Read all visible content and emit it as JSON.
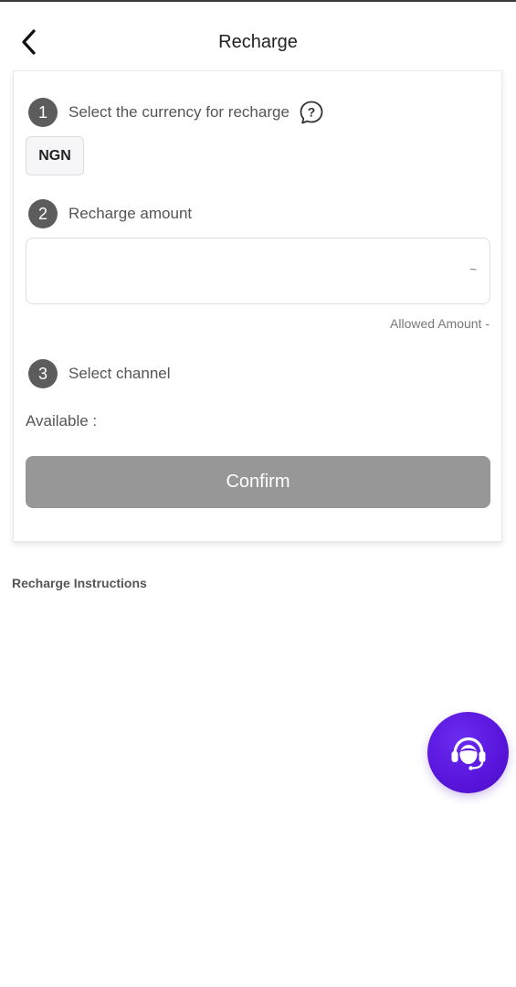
{
  "header": {
    "title": "Recharge",
    "back_icon": "chevron-left-icon"
  },
  "steps": [
    {
      "number": "1",
      "label": "Select the currency for recharge"
    },
    {
      "number": "2",
      "label": "Recharge amount"
    },
    {
      "number": "3",
      "label": "Select channel"
    }
  ],
  "currency": {
    "selected": "NGN"
  },
  "amount": {
    "value": "",
    "placeholder": "",
    "range_separator": "~",
    "allowed_label": "Allowed Amount -"
  },
  "channel": {
    "available_label": "Available :"
  },
  "confirm": {
    "label": "Confirm",
    "enabled": false
  },
  "instructions": {
    "title": "Recharge Instructions"
  },
  "support": {
    "icon": "customer-service-headset-icon"
  },
  "colors": {
    "step_badge": "#5c5c5c",
    "confirm_disabled": "#979797",
    "support_button": "#5a16dd"
  }
}
